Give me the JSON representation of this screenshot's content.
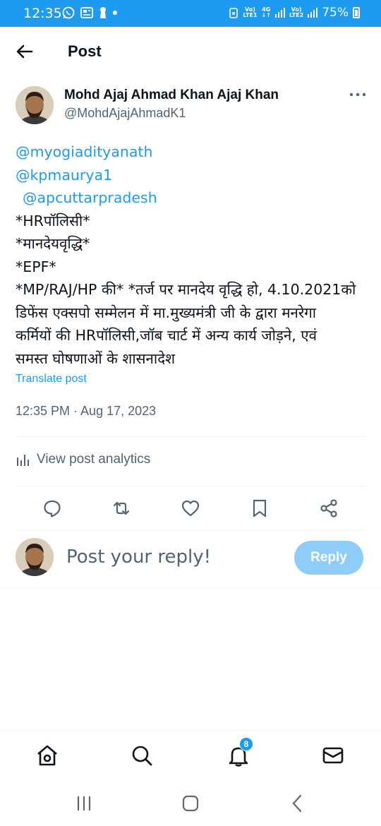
{
  "status_bar": {
    "time": "12:35",
    "sim1_label_top": "Vo)",
    "sim1_label_bottom": "LTE1",
    "network_top": "4G",
    "network_bottom": "↓↑",
    "sim2_label_top": "Vo)",
    "sim2_label_bottom": "LTE2",
    "battery": "75%"
  },
  "header": {
    "title": "Post"
  },
  "post": {
    "author_name": "Mohd Ajaj Ahmad Khan Ajaj Khan",
    "author_handle": "@MohdAjajAhmadK1",
    "mentions": [
      "@myogiadityanath",
      "@kpmaurya1",
      "@apcuttarpradesh"
    ],
    "lines": [
      "*HRपॉलिसी*",
      "*मानदेयवृद्धि*",
      "*EPF*",
      "*MP/RAJ/HP की* *तर्ज पर मानदेय वृद्धि हो, 4.10.2021को",
      "डिफेंस एक्सपो सम्मेलन में मा.मुख्यमंत्री जी के द्वारा मनरेगा",
      "कर्मियों की HRपॉलिसी,जॉब चार्ट में अन्य कार्य जोड़ने, एवं",
      "समस्त घोषणाओं के शासनादेश"
    ],
    "translate_label": "Translate post",
    "timestamp": "12:35 PM · Aug 17, 2023",
    "analytics_label": "View post analytics"
  },
  "actions": {
    "icons": [
      "comment-icon",
      "repost-icon",
      "like-icon",
      "bookmark-icon",
      "share-icon"
    ]
  },
  "reply": {
    "placeholder": "Post your reply!",
    "button_label": "Reply"
  },
  "bottom_nav": {
    "notification_count": "8"
  },
  "colors": {
    "accent": "#1d9bf0",
    "reply_button": "#8ecdf8",
    "secondary_text": "#536471"
  }
}
